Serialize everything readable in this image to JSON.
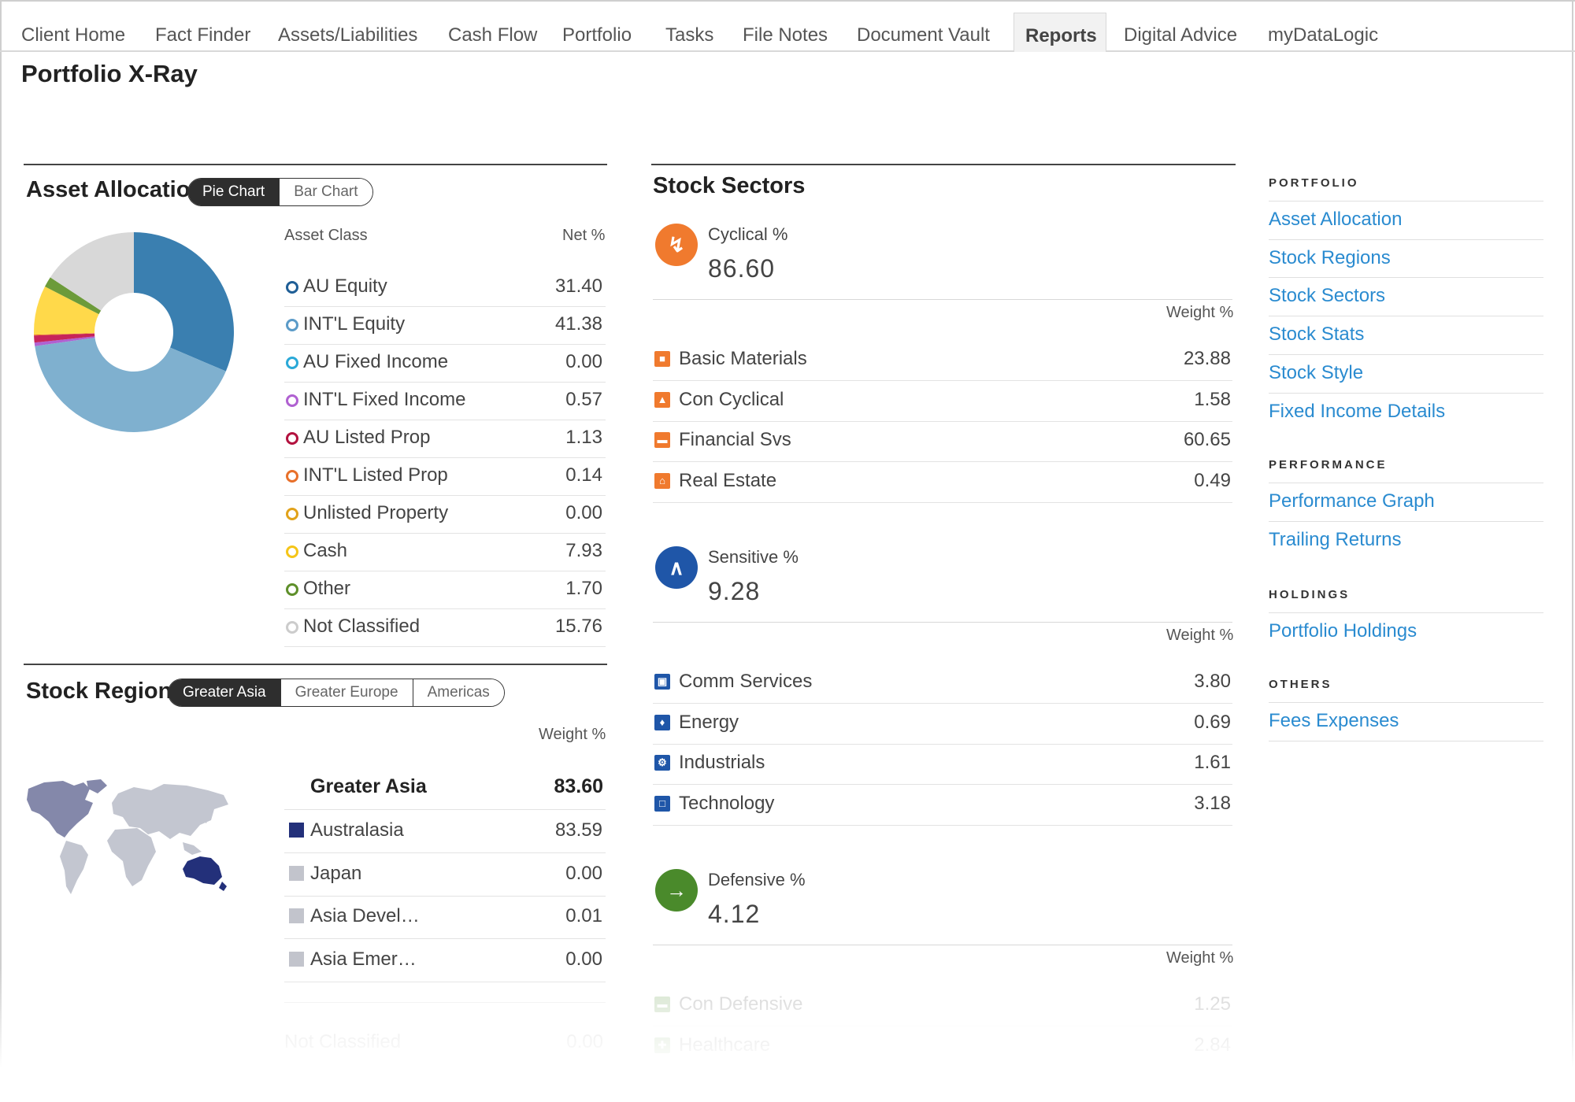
{
  "nav": {
    "tabs": [
      "Client Home",
      "Fact Finder",
      "Assets/Liabilities",
      "Cash Flow",
      "Portfolio",
      "Tasks",
      "File Notes",
      "Document Vault",
      "Reports",
      "Digital Advice",
      "myDataLogic"
    ],
    "active": "Reports"
  },
  "page": {
    "title": "Portfolio X-Ray"
  },
  "asset_allocation": {
    "title": "Asset Allocation",
    "toggle": [
      "Pie Chart",
      "Bar Chart"
    ],
    "active_toggle": "Pie Chart",
    "col_class": "Asset Class",
    "col_net": "Net %",
    "rows": [
      {
        "label": "AU Equity",
        "value": "31.40",
        "color": "#1f5e96"
      },
      {
        "label": "INT'L Equity",
        "value": "41.38",
        "color": "#5b9bc8"
      },
      {
        "label": "AU Fixed Income",
        "value": "0.00",
        "color": "#2aa9d8"
      },
      {
        "label": "INT'L Fixed Income",
        "value": "0.57",
        "color": "#b061d1"
      },
      {
        "label": "AU Listed Prop",
        "value": "1.13",
        "color": "#b3123f"
      },
      {
        "label": "INT'L Listed Prop",
        "value": "0.14",
        "color": "#e8702a"
      },
      {
        "label": "Unlisted Property",
        "value": "0.00",
        "color": "#e1a21a"
      },
      {
        "label": "Cash",
        "value": "7.93",
        "color": "#f5c518"
      },
      {
        "label": "Other",
        "value": "1.70",
        "color": "#5e8f2a"
      },
      {
        "label": "Not Classified",
        "value": "15.76",
        "color": "#cccccc"
      }
    ],
    "pie_colors": [
      "#3a7fb0",
      "#7fb0cf",
      "#2aa9d8",
      "#b061d1",
      "#c7245a",
      "#e8702a",
      "#e1a21a",
      "#ffd94a",
      "#6c9b3a",
      "#d8d8d8"
    ]
  },
  "stock_regions": {
    "title": "Stock Regions",
    "toggle": [
      "Greater Asia",
      "Greater Europe",
      "Americas"
    ],
    "active_toggle": "Greater Asia",
    "col_weight": "Weight %",
    "group_label": "Greater Asia",
    "group_value": "83.60",
    "rows": [
      {
        "label": "Australasia",
        "value": "83.59",
        "color": "#23307a"
      },
      {
        "label": "Japan",
        "value": "0.00",
        "color": "#c2c4cc"
      },
      {
        "label": "Asia Devel…",
        "value": "0.01",
        "color": "#c2c4cc"
      },
      {
        "label": "Asia Emer…",
        "value": "0.00",
        "color": "#c2c4cc"
      }
    ],
    "not_classified_label": "Not Classified",
    "not_classified_value": "0.00"
  },
  "stock_sectors": {
    "title": "Stock Sectors",
    "weight_label": "Weight %",
    "groups": [
      {
        "name": "Cyclical %",
        "value": "86.60",
        "color": "#f07a2e",
        "icon": "cyclical-icon",
        "rows": [
          {
            "label": "Basic Materials",
            "value": "23.88"
          },
          {
            "label": "Con Cyclical",
            "value": "1.58"
          },
          {
            "label": "Financial Svs",
            "value": "60.65"
          },
          {
            "label": "Real Estate",
            "value": "0.49"
          }
        ]
      },
      {
        "name": "Sensitive %",
        "value": "9.28",
        "color": "#1f56a8",
        "icon": "sensitive-icon",
        "rows": [
          {
            "label": "Comm Services",
            "value": "3.80"
          },
          {
            "label": "Energy",
            "value": "0.69"
          },
          {
            "label": "Industrials",
            "value": "1.61"
          },
          {
            "label": "Technology",
            "value": "3.18"
          }
        ]
      },
      {
        "name": "Defensive %",
        "value": "4.12",
        "color": "#4a8a2b",
        "icon": "defensive-icon",
        "rows": [
          {
            "label": "Con Defensive",
            "value": "1.25"
          },
          {
            "label": "Healthcare",
            "value": "2.84"
          }
        ]
      }
    ]
  },
  "sidebar": {
    "sections": [
      {
        "heading": "PORTFOLIO",
        "links": [
          "Asset Allocation",
          "Stock Regions",
          "Stock Sectors",
          "Stock Stats",
          "Stock Style",
          "Fixed Income Details"
        ]
      },
      {
        "heading": "PERFORMANCE",
        "links": [
          "Performance Graph",
          "Trailing Returns"
        ]
      },
      {
        "heading": "HOLDINGS",
        "links": [
          "Portfolio Holdings"
        ]
      },
      {
        "heading": "OTHERS",
        "links": [
          "Fees Expenses"
        ]
      }
    ]
  }
}
